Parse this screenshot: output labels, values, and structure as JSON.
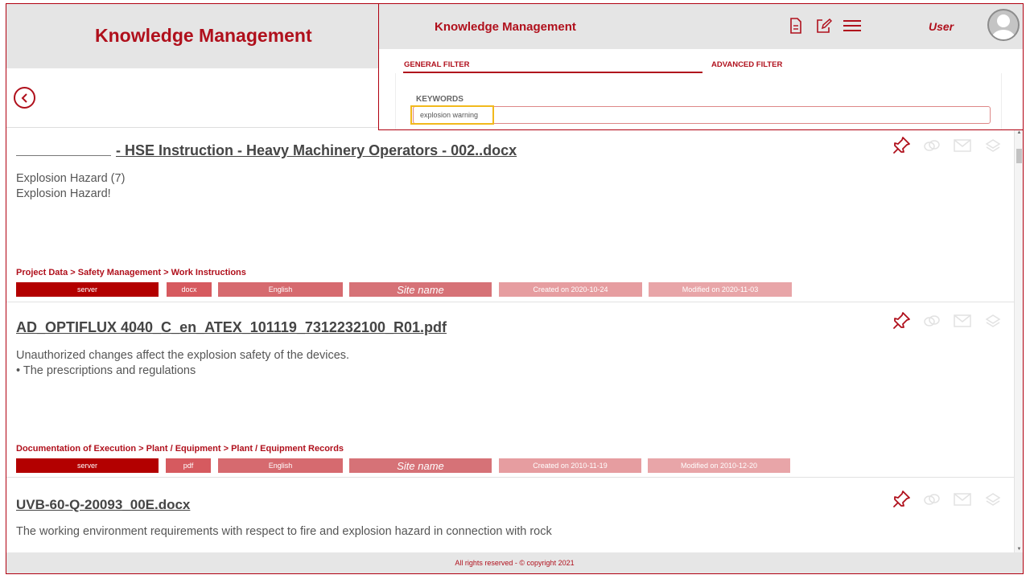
{
  "app": {
    "title": "Knowledge Management"
  },
  "footer": {
    "text": "All rights reserved - © copyright 2021"
  },
  "colors": {
    "brand": "#b0101c",
    "tag_server": "#b30000",
    "tag_format": "#d65a5f",
    "tag_language": "#d66a6f",
    "tag_site": "#d67277",
    "tag_created": "#e69da0",
    "tag_modified": "#e8a5a8",
    "search_highlight": "#f2b91c"
  },
  "overlay": {
    "title": "Knowledge Management",
    "user": "User",
    "icons": [
      "document-icon",
      "edit-icon",
      "menu-icon"
    ],
    "tabs": {
      "general": "GENERAL FILTER",
      "advanced": "ADVANCED FILTER"
    },
    "keywords_label": "KEYWORDS",
    "keywords_value": "explosion warning"
  },
  "results": [
    {
      "title": "- HSE Instruction - Heavy Machinery Operators - 002..docx",
      "snippet": [
        "Explosion Hazard (7)",
        "Explosion Hazard!"
      ],
      "path": "Project Data > Safety Management > Work Instructions",
      "tags": {
        "source": "server",
        "format": "docx",
        "language": "English",
        "site": "Site name",
        "created": "Created on 2020-10-24",
        "modified": "Modified on 2020-11-03"
      }
    },
    {
      "title": "AD_OPTIFLUX 4040_C_en_ATEX_101119_7312232100_R01.pdf",
      "snippet": [
        "Unauthorized changes affect the explosion safety of the devices.",
        "• The prescriptions and regulations"
      ],
      "path": "Documentation of Execution > Plant / Equipment > Plant / Equipment Records",
      "tags": {
        "source": "server",
        "format": "pdf",
        "language": "English",
        "site": "Site name",
        "created": "Created on 2010-11-19",
        "modified": "Modified on 2010-12-20"
      }
    },
    {
      "title": "UVB-60-Q-20093_00E.docx",
      "snippet": [
        "The working environment requirements with respect to fire and explosion hazard in connection with rock"
      ]
    }
  ]
}
